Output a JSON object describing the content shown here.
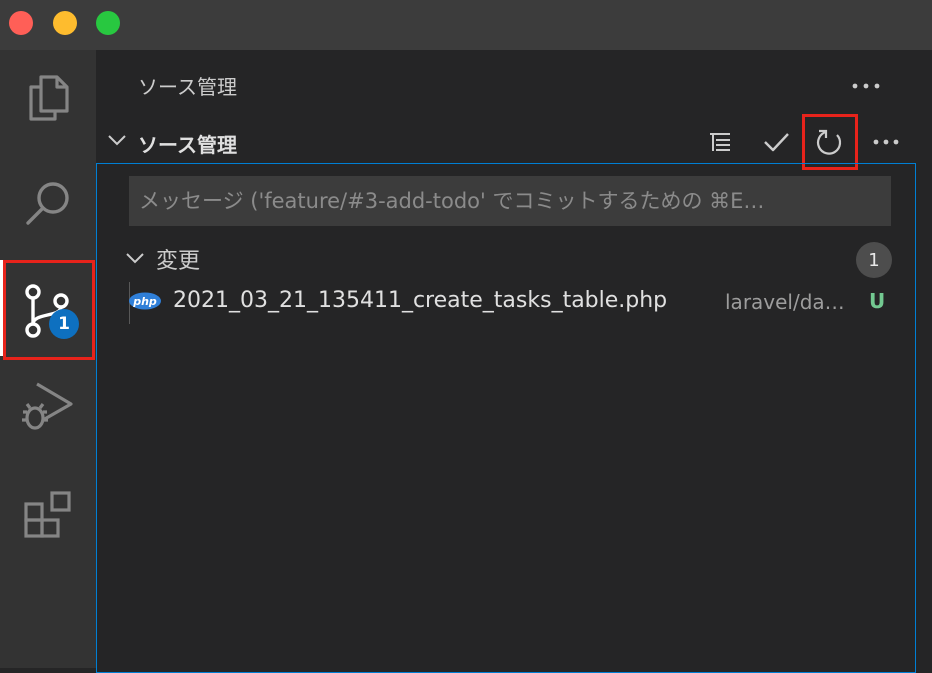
{
  "sidebar": {
    "title": "ソース管理"
  },
  "scm": {
    "section_title": "ソース管理",
    "commit_placeholder": "メッセージ ('feature/#3-add-todo' でコミットするための ⌘E…",
    "changes_label": "変更",
    "changes_count": "1",
    "files": [
      {
        "name": "2021_03_21_135411_create_tasks_table.php",
        "path": "laravel/da…",
        "status": "U",
        "icon": "php-icon"
      }
    ]
  },
  "activity_bar": {
    "items": [
      "explorer-icon",
      "search-icon",
      "source-control-icon",
      "run-debug-icon",
      "extensions-icon"
    ],
    "scm_badge": "1"
  },
  "colors": {
    "accent": "#007fd4",
    "badge": "#0e70c0",
    "highlight": "#e8231b",
    "untracked": "#73c991"
  }
}
